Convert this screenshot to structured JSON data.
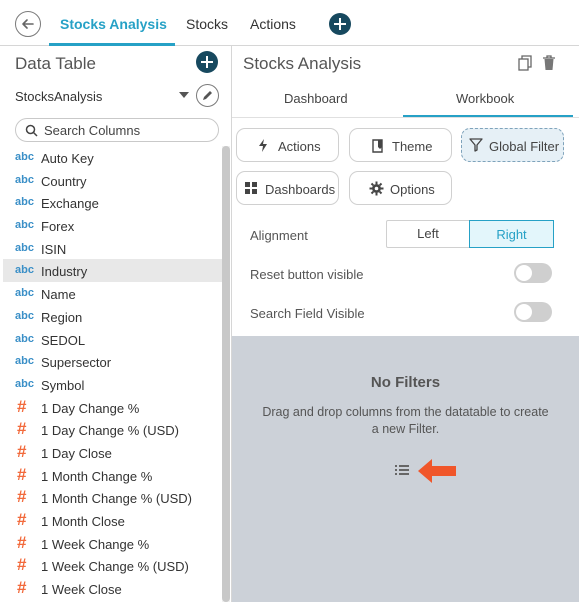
{
  "topbar": {
    "tabs": [
      {
        "label": "Stocks Analysis",
        "active": true
      },
      {
        "label": "Stocks",
        "active": false
      },
      {
        "label": "Actions",
        "active": false
      }
    ]
  },
  "left_panel": {
    "title": "Data Table",
    "dataset": "StocksAnalysis",
    "search_placeholder": "Search Columns",
    "columns": [
      {
        "type": "abc",
        "label": "Auto Key"
      },
      {
        "type": "abc",
        "label": "Country"
      },
      {
        "type": "abc",
        "label": "Exchange"
      },
      {
        "type": "abc",
        "label": "Forex"
      },
      {
        "type": "abc",
        "label": "ISIN"
      },
      {
        "type": "abc",
        "label": "Industry",
        "selected": true
      },
      {
        "type": "abc",
        "label": "Name"
      },
      {
        "type": "abc",
        "label": "Region"
      },
      {
        "type": "abc",
        "label": "SEDOL"
      },
      {
        "type": "abc",
        "label": "Supersector"
      },
      {
        "type": "abc",
        "label": "Symbol"
      },
      {
        "type": "#",
        "label": "1 Day Change %"
      },
      {
        "type": "#",
        "label": "1 Day Change % (USD)"
      },
      {
        "type": "#",
        "label": "1 Day Close"
      },
      {
        "type": "#",
        "label": "1 Month Change %"
      },
      {
        "type": "#",
        "label": "1 Month Change % (USD)"
      },
      {
        "type": "#",
        "label": "1 Month Close"
      },
      {
        "type": "#",
        "label": "1 Week Change %"
      },
      {
        "type": "#",
        "label": "1 Week Change % (USD)"
      },
      {
        "type": "#",
        "label": "1 Week Close"
      }
    ]
  },
  "right_panel": {
    "title": "Stocks Analysis",
    "sub_tabs": {
      "dashboard": "Dashboard",
      "workbook": "Workbook"
    },
    "buttons": {
      "actions": "Actions",
      "theme": "Theme",
      "global_filter": "Global Filter",
      "dashboards": "Dashboards",
      "options": "Options"
    },
    "alignment": {
      "label": "Alignment",
      "left": "Left",
      "right": "Right",
      "selected": "Right"
    },
    "reset_button": {
      "label": "Reset button visible",
      "on": false
    },
    "search_field": {
      "label": "Search Field Visible",
      "on": false
    },
    "drop_zone": {
      "title": "No Filters",
      "description": "Drag and drop columns from the datatable to create a new Filter."
    }
  },
  "colors": {
    "accent": "#26a1c6",
    "dark_plus": "#17495f",
    "text_type": "#3a8fc7",
    "numeric_type": "#f26a3c",
    "drop_zone_bg": "#ccd1d8",
    "arrow": "#f0562a"
  },
  "icons": [
    "back-arrow-icon",
    "plus-icon",
    "pencil-icon",
    "search-icon",
    "copy-icon",
    "trash-icon",
    "lightning-icon",
    "theme-icon",
    "filter-icon",
    "grid-icon",
    "gear-icon",
    "list-icon",
    "arrow-left-icon"
  ]
}
